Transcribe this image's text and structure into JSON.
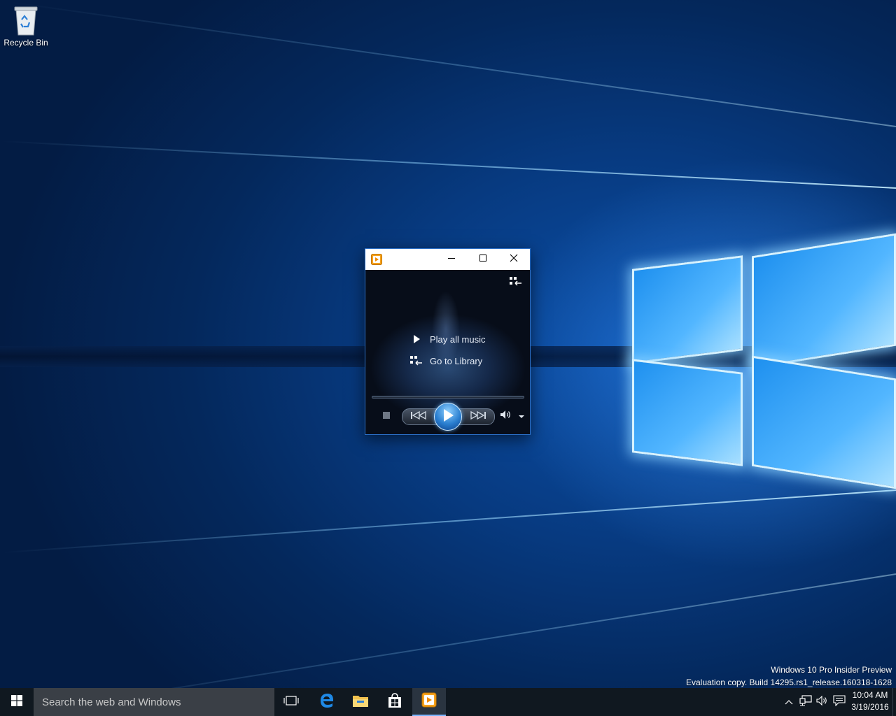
{
  "desktop": {
    "icons": [
      {
        "label": "Recycle Bin",
        "icon": "recycle-bin-icon"
      }
    ],
    "watermark": {
      "line1": "Windows 10 Pro Insider Preview",
      "line2": "Evaluation copy. Build 14295.rs1_release.160318-1628"
    }
  },
  "window": {
    "app_icon": "windows-media-player-icon",
    "controls": {
      "minimize": "minimize-icon",
      "maximize": "maximize-icon",
      "close": "close-icon"
    },
    "content": {
      "switch_to_library_icon": "switch-to-library-icon",
      "links": [
        {
          "label": "Play all music",
          "icon": "play-icon"
        },
        {
          "label": "Go to Library",
          "icon": "library-icon"
        }
      ]
    },
    "playback": {
      "stop": "stop-icon",
      "previous": "previous-icon",
      "play": "play-icon",
      "next": "next-icon",
      "mute": "speaker-icon",
      "volume_menu": "chevron-down-icon"
    }
  },
  "taskbar": {
    "search_placeholder": "Search the web and Windows",
    "apps": [
      "task-view-icon",
      "edge-icon",
      "file-explorer-icon",
      "store-icon",
      "windows-media-player-icon"
    ],
    "tray": [
      "chevron-up-icon",
      "network-icon",
      "volume-icon",
      "action-center-icon"
    ],
    "time": "10:04 AM",
    "date": "3/19/2016"
  },
  "colors": {
    "accent": "#0078d7",
    "taskbar": "#101820",
    "search_box": "#3a3f46"
  }
}
